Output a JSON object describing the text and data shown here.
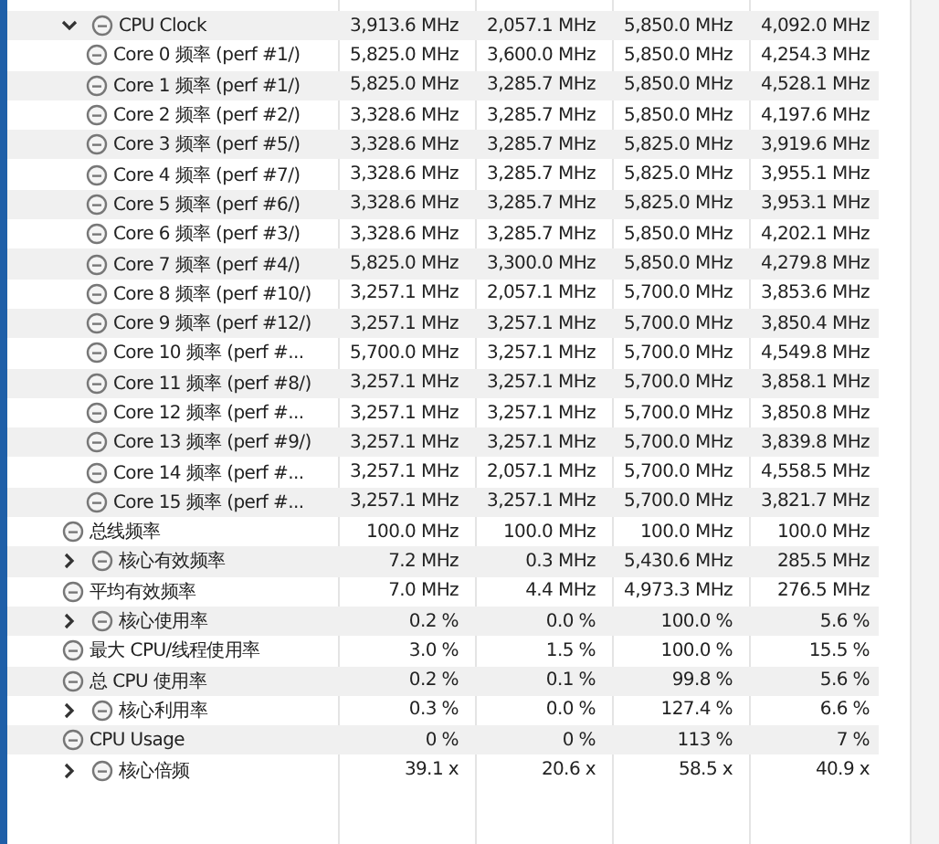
{
  "rows": [
    {
      "label": "CPU Clock",
      "values": [
        "3,913.6 MHz",
        "2,057.1 MHz",
        "5,850.0 MHz",
        "4,092.0 MHz"
      ],
      "expanded": true,
      "children": [
        {
          "label": "Core 0 频率 (perf #1/)",
          "values": [
            "5,825.0 MHz",
            "3,600.0 MHz",
            "5,850.0 MHz",
            "4,254.3 MHz"
          ]
        },
        {
          "label": "Core 1 频率 (perf #1/)",
          "values": [
            "5,825.0 MHz",
            "3,285.7 MHz",
            "5,850.0 MHz",
            "4,528.1 MHz"
          ]
        },
        {
          "label": "Core 2 频率 (perf #2/)",
          "values": [
            "3,328.6 MHz",
            "3,285.7 MHz",
            "5,850.0 MHz",
            "4,197.6 MHz"
          ]
        },
        {
          "label": "Core 3 频率 (perf #5/)",
          "values": [
            "3,328.6 MHz",
            "3,285.7 MHz",
            "5,825.0 MHz",
            "3,919.6 MHz"
          ]
        },
        {
          "label": "Core 4 频率 (perf #7/)",
          "values": [
            "3,328.6 MHz",
            "3,285.7 MHz",
            "5,825.0 MHz",
            "3,955.1 MHz"
          ]
        },
        {
          "label": "Core 5 频率 (perf #6/)",
          "values": [
            "3,328.6 MHz",
            "3,285.7 MHz",
            "5,825.0 MHz",
            "3,953.1 MHz"
          ]
        },
        {
          "label": "Core 6 频率 (perf #3/)",
          "values": [
            "3,328.6 MHz",
            "3,285.7 MHz",
            "5,850.0 MHz",
            "4,202.1 MHz"
          ]
        },
        {
          "label": "Core 7 频率 (perf #4/)",
          "values": [
            "5,825.0 MHz",
            "3,300.0 MHz",
            "5,850.0 MHz",
            "4,279.8 MHz"
          ]
        },
        {
          "label": "Core 8 频率 (perf #10/)",
          "values": [
            "3,257.1 MHz",
            "2,057.1 MHz",
            "5,700.0 MHz",
            "3,853.6 MHz"
          ]
        },
        {
          "label": "Core 9 频率 (perf #12/)",
          "values": [
            "3,257.1 MHz",
            "3,257.1 MHz",
            "5,700.0 MHz",
            "3,850.4 MHz"
          ]
        },
        {
          "label": "Core 10 频率 (perf #...",
          "values": [
            "5,700.0 MHz",
            "3,257.1 MHz",
            "5,700.0 MHz",
            "4,549.8 MHz"
          ]
        },
        {
          "label": "Core 11 频率 (perf #8/)",
          "values": [
            "3,257.1 MHz",
            "3,257.1 MHz",
            "5,700.0 MHz",
            "3,858.1 MHz"
          ]
        },
        {
          "label": "Core 12 频率 (perf #...",
          "values": [
            "3,257.1 MHz",
            "3,257.1 MHz",
            "5,700.0 MHz",
            "3,850.8 MHz"
          ]
        },
        {
          "label": "Core 13 频率 (perf #9/)",
          "values": [
            "3,257.1 MHz",
            "3,257.1 MHz",
            "5,700.0 MHz",
            "3,839.8 MHz"
          ]
        },
        {
          "label": "Core 14 频率 (perf #...",
          "values": [
            "3,257.1 MHz",
            "2,057.1 MHz",
            "5,700.0 MHz",
            "4,558.5 MHz"
          ]
        },
        {
          "label": "Core 15 频率 (perf #...",
          "values": [
            "3,257.1 MHz",
            "3,257.1 MHz",
            "5,700.0 MHz",
            "3,821.7 MHz"
          ]
        }
      ]
    },
    {
      "label": "总线频率",
      "values": [
        "100.0 MHz",
        "100.0 MHz",
        "100.0 MHz",
        "100.0 MHz"
      ]
    },
    {
      "label": "核心有效频率",
      "values": [
        "7.2 MHz",
        "0.3 MHz",
        "5,430.6 MHz",
        "285.5 MHz"
      ],
      "expanded": false
    },
    {
      "label": "平均有效频率",
      "values": [
        "7.0 MHz",
        "4.4 MHz",
        "4,973.3 MHz",
        "276.5 MHz"
      ]
    },
    {
      "label": "核心使用率",
      "values": [
        "0.2 %",
        "0.0 %",
        "100.0 %",
        "5.6 %"
      ],
      "expanded": false
    },
    {
      "label": "最大 CPU/线程使用率",
      "values": [
        "3.0 %",
        "1.5 %",
        "100.0 %",
        "15.5 %"
      ]
    },
    {
      "label": "总 CPU 使用率",
      "values": [
        "0.2 %",
        "0.1 %",
        "99.8 %",
        "5.6 %"
      ]
    },
    {
      "label": "核心利用率",
      "values": [
        "0.3 %",
        "0.0 %",
        "127.4 %",
        "6.6 %"
      ],
      "expanded": false
    },
    {
      "label": "CPU Usage",
      "values": [
        "0 %",
        "0 %",
        "113 %",
        "7 %"
      ]
    },
    {
      "label": "核心倍频",
      "values": [
        "39.1 x",
        "20.6 x",
        "58.5 x",
        "40.9 x"
      ],
      "expanded": false
    }
  ]
}
